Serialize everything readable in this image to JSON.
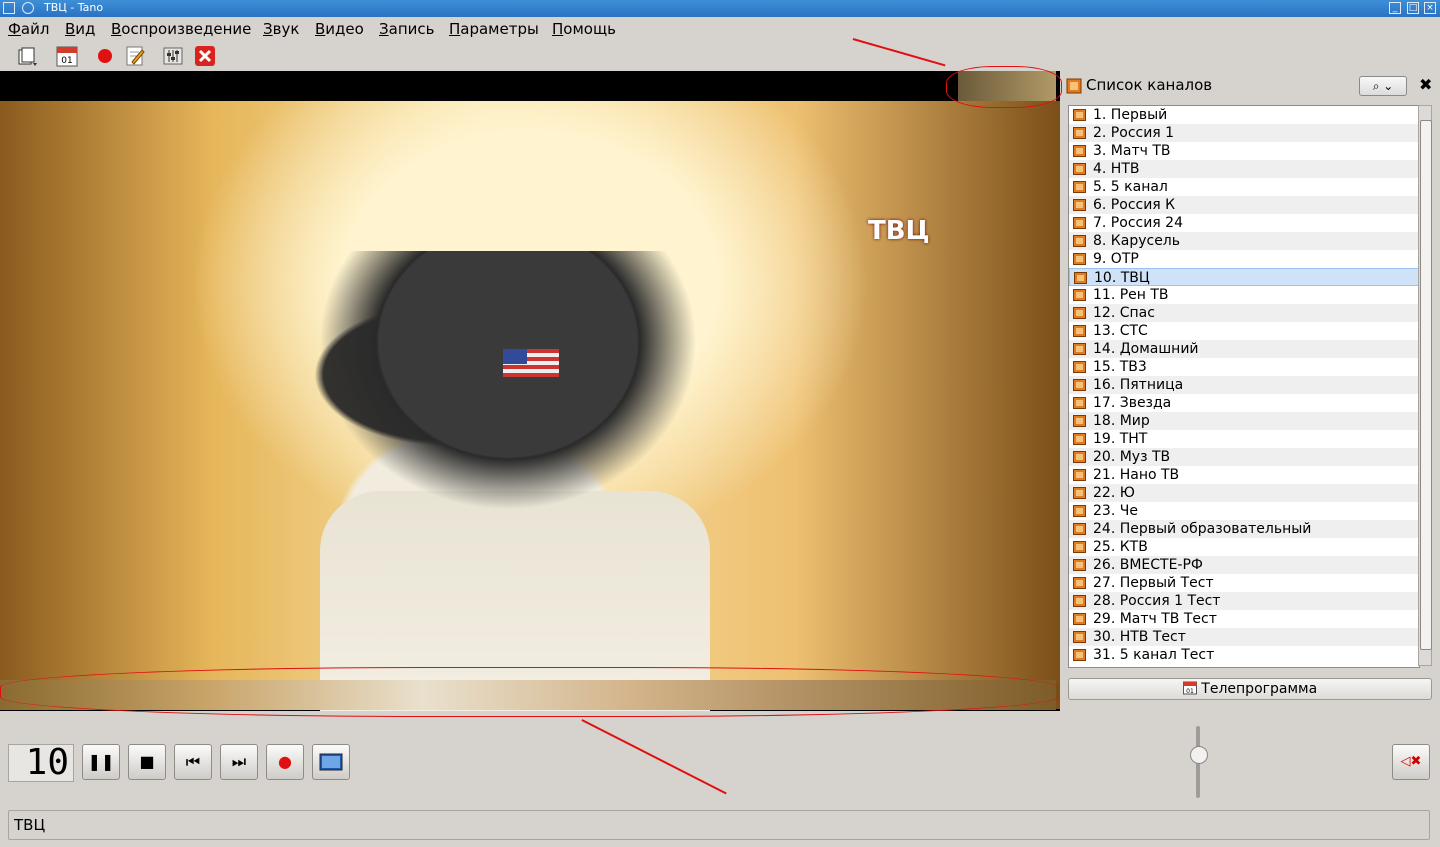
{
  "window": {
    "title": "ТВЦ - Tano",
    "min_icon": "minimize-icon",
    "max_icon": "maximize-icon",
    "close_icon": "close-icon"
  },
  "menu": [
    "Файл",
    "Вид",
    "Воспроизведение",
    "Звук",
    "Видео",
    "Запись",
    "Параметры",
    "Помощь"
  ],
  "toolbar": {
    "icons": [
      "playlist-icon",
      "calendar-icon",
      "record-icon",
      "edit-icon",
      "equalizer-icon",
      "stop-icon"
    ],
    "calendar_label": "01"
  },
  "video": {
    "channel_logo": "ТВЦ"
  },
  "channel_panel": {
    "title": "Список каналов",
    "search_icon": "search-icon",
    "close_icon": "close-icon",
    "selected_index": 9,
    "channels": [
      "1.  Первый",
      "2.  Россия 1",
      "3.  Матч ТВ",
      "4.  НТВ",
      "5.  5 канал",
      "6.  Россия К",
      "7.  Россия 24",
      "8.  Карусель",
      "9.  ОТР",
      "10.  ТВЦ",
      "11.  Рен ТВ",
      "12.  Спас",
      "13.  СТС",
      "14.  Домашний",
      "15.  ТВ3",
      "16.  Пятница",
      "17.  Звезда",
      "18.  Мир",
      "19.  ТНТ",
      "20.  Муз ТВ",
      "21.  Нано ТВ",
      "22.  Ю",
      "23.  Че",
      "24.  Первый образовательный",
      "25.  КТВ",
      "26.  ВМЕСТЕ-РФ",
      "27.  Первый Тест",
      "28.  Россия 1 Тест",
      "29.  Матч ТВ Тест",
      "30.  НТВ Тест",
      "31.  5 канал Тест"
    ],
    "epg_button": "Телепрограмма",
    "epg_icon_label": "01"
  },
  "controls": {
    "channel_number": "10",
    "buttons": [
      "pause",
      "stop",
      "previous",
      "next",
      "record",
      "screenshot"
    ]
  },
  "status": {
    "text": "ТВЦ"
  }
}
